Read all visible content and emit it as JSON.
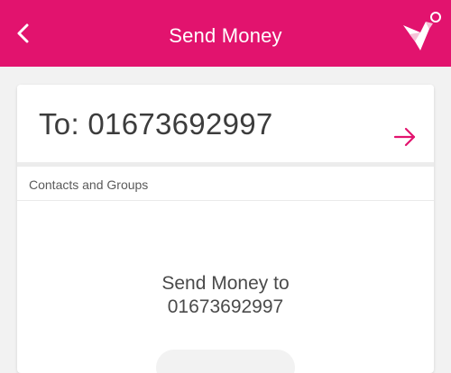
{
  "header": {
    "title": "Send Money",
    "background_color": "#e2136e",
    "back_icon": "chevron-left-icon",
    "logo_icon": "bird-logo-icon"
  },
  "recipient": {
    "to_text": "To: 01673692997",
    "next_icon": "arrow-right-icon",
    "accent_color": "#e2136e"
  },
  "contacts": {
    "section_label": "Contacts and Groups"
  },
  "suggestion": {
    "line1": "Send Money to",
    "line2": "01673692997"
  }
}
